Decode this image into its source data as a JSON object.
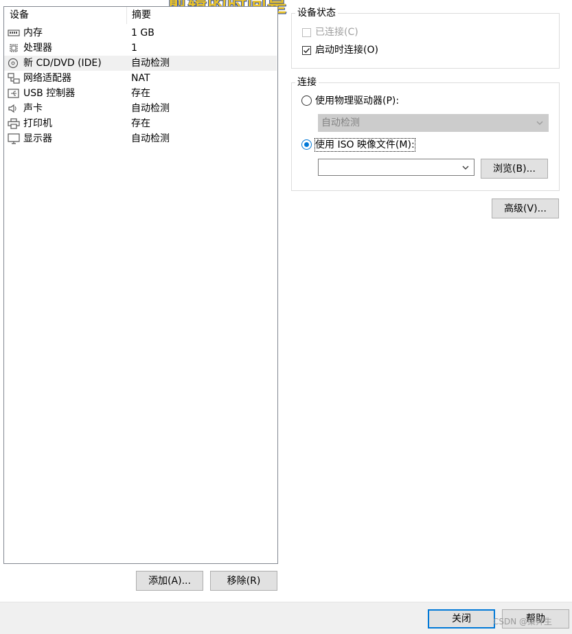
{
  "overlay_title": "剪辑的时间是",
  "device_list": {
    "col_device": "设备",
    "col_summary": "摘要",
    "rows": [
      {
        "name": "内存",
        "summary": "1 GB",
        "icon": "memory-icon"
      },
      {
        "name": "处理器",
        "summary": "1",
        "icon": "processor-icon"
      },
      {
        "name": "新 CD/DVD (IDE)",
        "summary": "自动检测",
        "icon": "cd-dvd-icon",
        "selected": true
      },
      {
        "name": "网络适配器",
        "summary": "NAT",
        "icon": "network-adapter-icon"
      },
      {
        "name": "USB 控制器",
        "summary": "存在",
        "icon": "usb-icon"
      },
      {
        "name": "声卡",
        "summary": "自动检测",
        "icon": "speaker-icon"
      },
      {
        "name": "打印机",
        "summary": "存在",
        "icon": "printer-icon"
      },
      {
        "name": "显示器",
        "summary": "自动检测",
        "icon": "monitor-icon"
      }
    ]
  },
  "list_buttons": {
    "add": "添加(A)...",
    "remove": "移除(R)"
  },
  "device_status": {
    "title": "设备状态",
    "connected": "已连接(C)",
    "connect_on_start": "启动时连接(O)",
    "connected_checked": false,
    "connect_on_start_checked": true
  },
  "connection": {
    "title": "连接",
    "physical_drive": "使用物理驱动器(P):",
    "physical_drive_value": "自动检测",
    "iso_image": "使用 ISO 映像文件(M):",
    "iso_path": "",
    "browse": "浏览(B)...",
    "selected": "iso"
  },
  "advanced_button": "高级(V)...",
  "footer": {
    "close": "关闭",
    "help": "帮助"
  },
  "watermark": "CSDN @策奔生",
  "colors": {
    "accent": "#0078d7",
    "selected_row": "#f0f0f0",
    "disabled_text": "#a0a0a0"
  }
}
